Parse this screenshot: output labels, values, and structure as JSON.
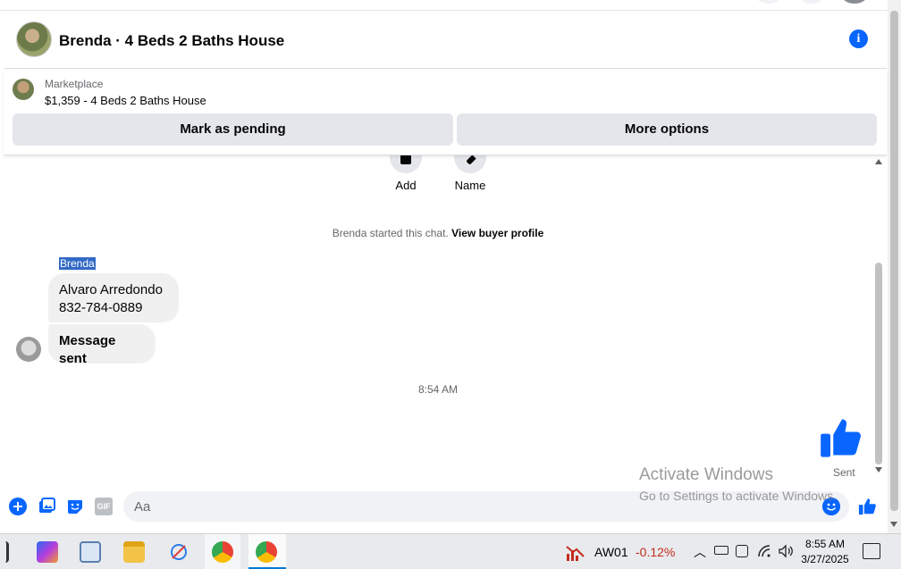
{
  "header": {
    "title": "Brenda · 4 Beds 2 Baths House",
    "info_icon": "info-icon"
  },
  "marketplace": {
    "label": "Marketplace",
    "listing": "$1,359 - 4 Beds 2 Baths House",
    "mark_pending_label": "Mark as pending",
    "more_options_label": "More options"
  },
  "actions": {
    "add_label": "Add",
    "name_label": "Name"
  },
  "chat": {
    "started_text": "Brenda started this chat.",
    "view_profile_label": "View buyer profile",
    "sender_name": "Brenda",
    "message_1_line_1": "Alvaro Arredondo",
    "message_1_line_2": "832-784-0889",
    "message_2": "Message sent",
    "timestamp": "8:54 AM",
    "sent_status": "Sent"
  },
  "composer": {
    "placeholder": "Aa",
    "icons": [
      "plus-icon",
      "image-icon",
      "sticker-icon",
      "gif-icon",
      "emoji-icon",
      "thumbs-up-icon"
    ],
    "gif_label": "GIF"
  },
  "watermark": {
    "line_1": "Activate Windows",
    "line_2": "Go to Settings to activate Windows."
  },
  "taskbar": {
    "stock_symbol": "AW01",
    "stock_change": "-0.12%",
    "time": "8:55 AM",
    "date": "3/27/2025"
  },
  "colors": {
    "accent": "#0866ff",
    "bubble": "#f0f0f0",
    "button": "#e4e6eb",
    "stock_negative": "#c42b1c"
  }
}
